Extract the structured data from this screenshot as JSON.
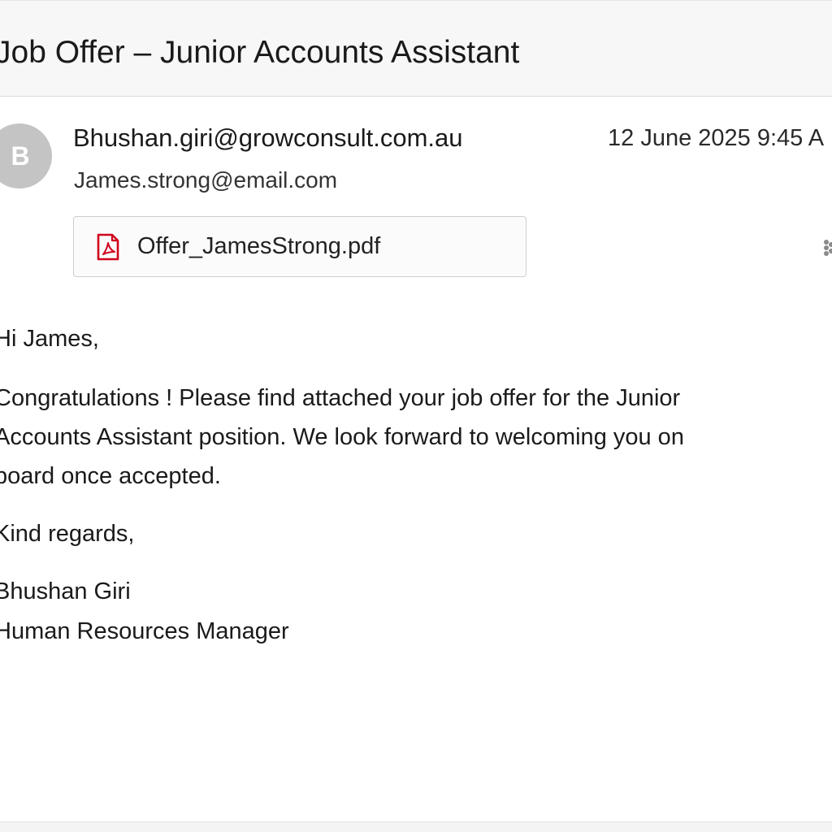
{
  "email": {
    "subject": "Job Offer – Junior Accounts Assistant",
    "avatar_initial": "B",
    "sender": "Bhushan.giri@growconsult.com.au",
    "recipient": "James.strong@email.com",
    "timestamp": "12 June 2025 9:45 A",
    "attachment": {
      "filename": "Offer_JamesStrong.pdf",
      "icon": "pdf-icon",
      "icon_color": "#d0021b"
    },
    "more_actions_icon": "more-options-icon",
    "body": {
      "greeting": "Hi James,",
      "paragraph_lines": [
        "Congratulations ! Please find attached your job offer for the Junior",
        "Accounts Assistant position. We look forward to welcoming you on",
        "board once accepted."
      ],
      "signoff": "Kind regards,",
      "signature_name": "Bhushan Giri",
      "signature_title": "Human Resources Manager"
    }
  },
  "colors": {
    "avatar_bg": "#c4c4c4",
    "header_bg": "#f7f7f7"
  }
}
